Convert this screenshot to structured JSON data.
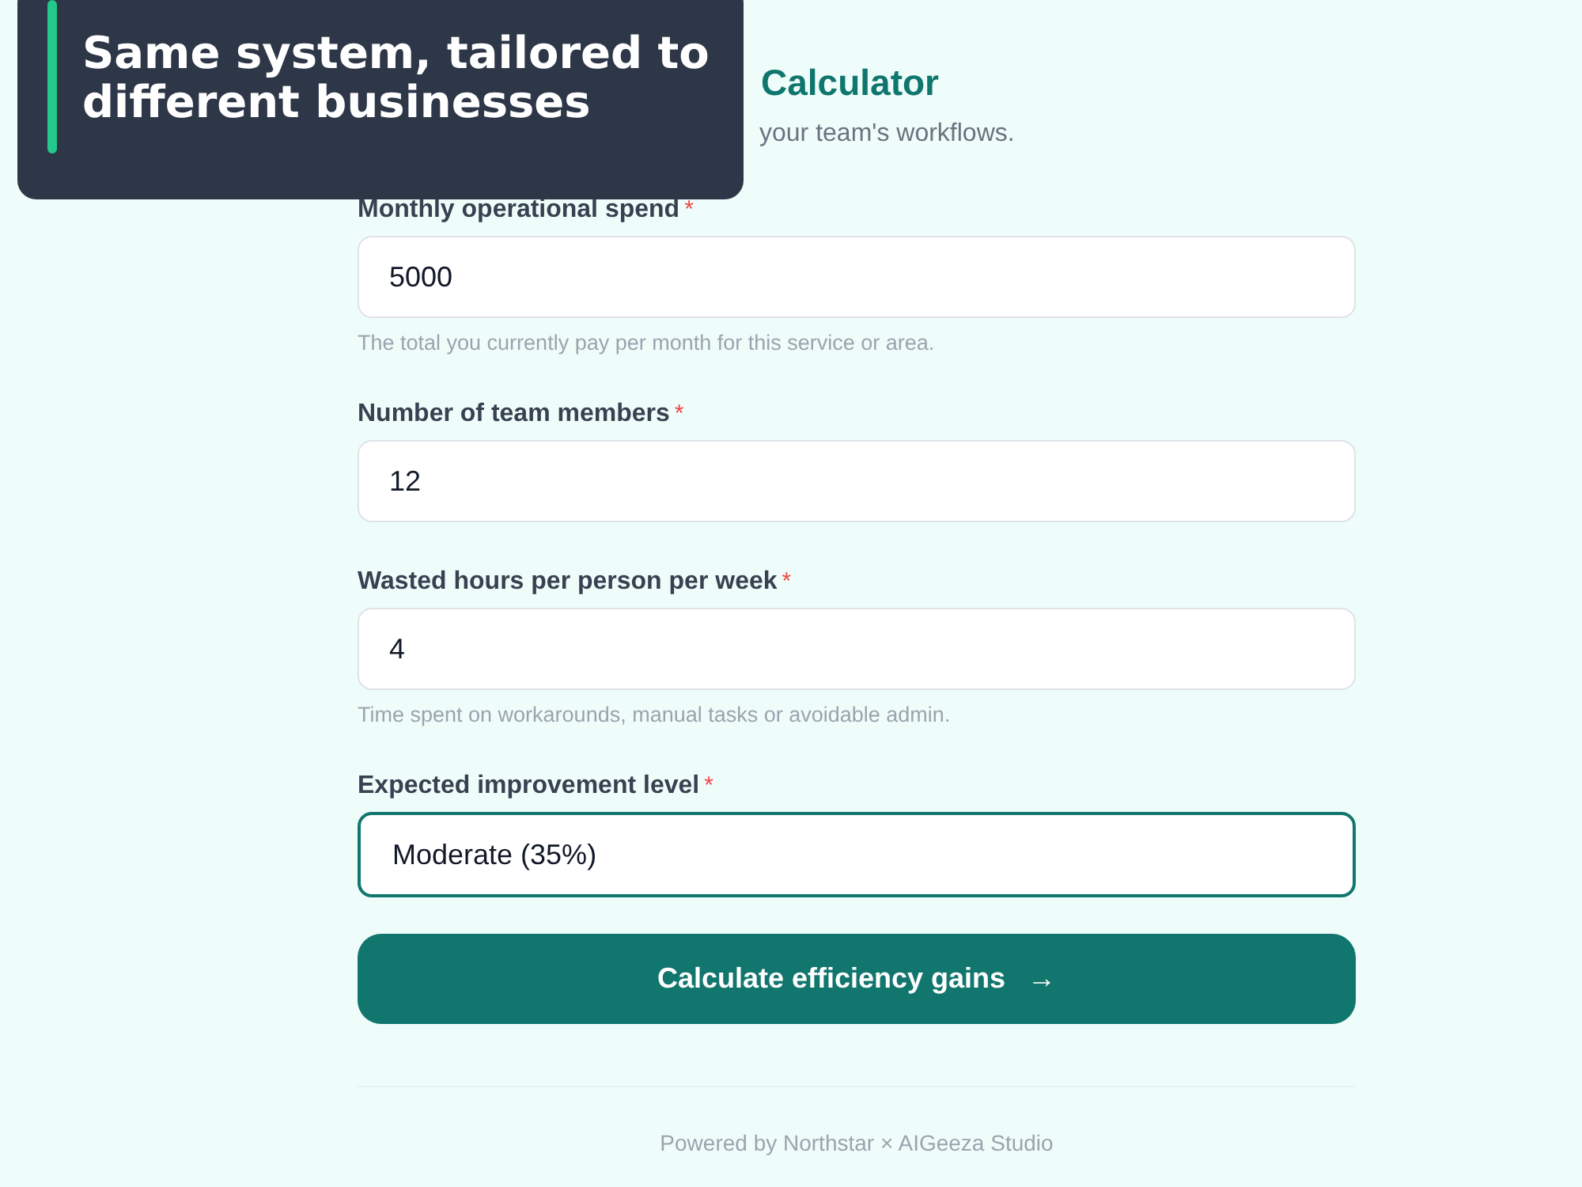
{
  "caption": {
    "text": "Same system, tailored to different businesses"
  },
  "title": "Calculator",
  "subtitle": "your team's workflows.",
  "fields": [
    {
      "label": "Monthly operational spend",
      "marker": "*",
      "value": "5000",
      "focused": false,
      "help": "The total you currently pay per month for this service or area."
    },
    {
      "label": "Number of team members",
      "marker": "*",
      "value": "12",
      "focused": false
    },
    {
      "label": "Wasted hours per person per week",
      "marker": "*",
      "value": "4",
      "focused": false,
      "help": "Time spent on workarounds, manual tasks or avoidable admin."
    },
    {
      "label": "Expected improvement level",
      "marker": "*",
      "value": "Moderate (35%)",
      "focused": true
    }
  ],
  "submit": {
    "label": "Calculate efficiency gains",
    "arrow": "→"
  },
  "footer": "Powered by Northstar × AIGeeza Studio"
}
